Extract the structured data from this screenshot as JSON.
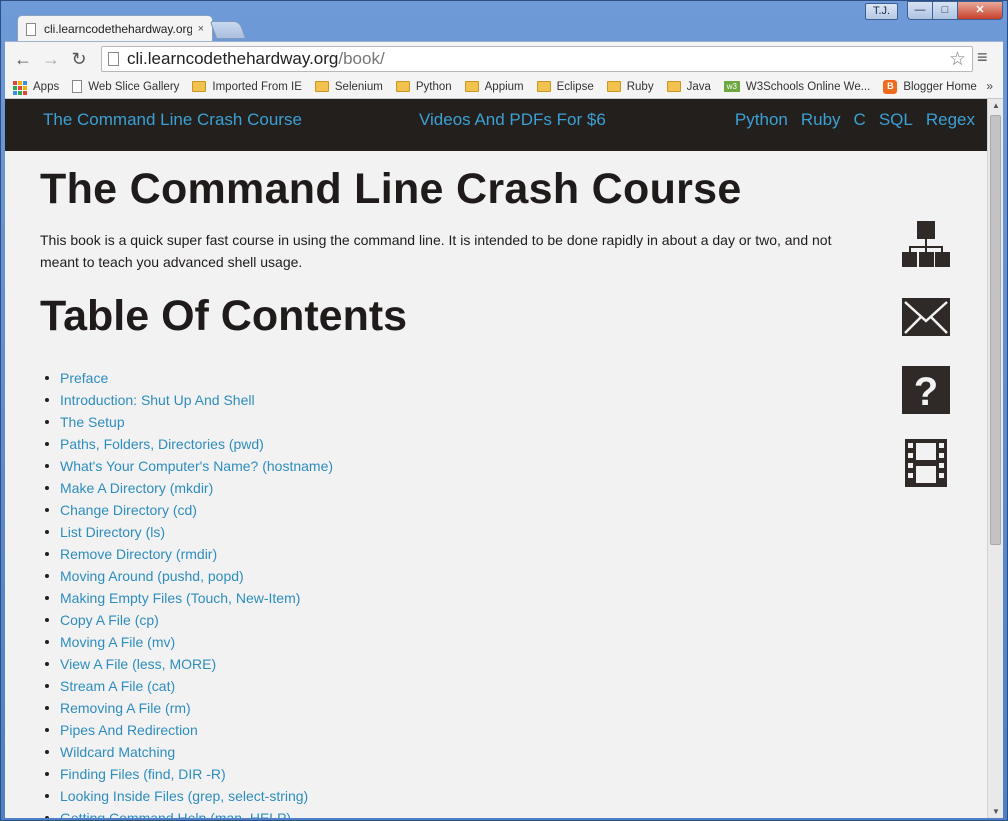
{
  "browser": {
    "tab_title": "cli.learncodethehardway.org",
    "tab_close": "×",
    "user_badge": "T.J.",
    "window_controls": {
      "minimize": "—",
      "maximize": "□",
      "close": "✕"
    },
    "nav": {
      "back": "←",
      "forward": "→",
      "reload": "↻",
      "star": "☆",
      "menu": "≡"
    },
    "url_host": "cli.learncodethehardway.org",
    "url_path": "/book/",
    "bookmarks": [
      {
        "label": "Apps",
        "icon": "apps-grid-icon"
      },
      {
        "label": "Web Slice Gallery",
        "icon": "page-icon"
      },
      {
        "label": "Imported From IE",
        "icon": "folder-icon"
      },
      {
        "label": "Selenium",
        "icon": "folder-icon"
      },
      {
        "label": "Python",
        "icon": "folder-icon"
      },
      {
        "label": "Appium",
        "icon": "folder-icon"
      },
      {
        "label": "Eclipse",
        "icon": "folder-icon"
      },
      {
        "label": "Ruby",
        "icon": "folder-icon"
      },
      {
        "label": "Java",
        "icon": "folder-icon"
      },
      {
        "label": "W3Schools Online We...",
        "icon": "w3schools-icon"
      },
      {
        "label": "Blogger Home",
        "icon": "blogger-icon"
      }
    ],
    "bookmarks_more": "»",
    "w3_icon_text": "w3",
    "blogger_icon_text": "B"
  },
  "site": {
    "nav": {
      "left": "The Command Line Crash Course",
      "center": "Videos And PDFs For $6",
      "right": [
        "Python",
        "Ruby",
        "C",
        "SQL",
        "Regex"
      ]
    },
    "title": "The Command Line Crash Course",
    "intro": "This book is a quick super fast course in using the command line. It is intended to be done rapidly in about a day or two, and not meant to teach you advanced shell usage.",
    "toc_heading": "Table Of Contents",
    "toc": [
      "Preface",
      "Introduction: Shut Up And Shell",
      "The Setup",
      "Paths, Folders, Directories (pwd)",
      "What's Your Computer's Name? (hostname)",
      "Make A Directory (mkdir)",
      "Change Directory (cd)",
      "List Directory (ls)",
      "Remove Directory (rmdir)",
      "Moving Around (pushd, popd)",
      "Making Empty Files (Touch, New-Item)",
      "Copy A File (cp)",
      "Moving A File (mv)",
      "View A File (less, MORE)",
      "Stream A File (cat)",
      "Removing A File (rm)",
      "Pipes And Redirection",
      "Wildcard Matching",
      "Finding Files (find, DIR -R)",
      "Looking Inside Files (grep, select-string)",
      "Getting Command Help (man, HELP)"
    ],
    "side_icons": [
      "sitemap-icon",
      "mail-icon",
      "help-icon",
      "video-icon"
    ],
    "colors": {
      "link": "#2d8dbf",
      "nav_bg": "#231f1d",
      "nav_link": "#3ba0d3",
      "text": "#1f1b1b"
    }
  }
}
